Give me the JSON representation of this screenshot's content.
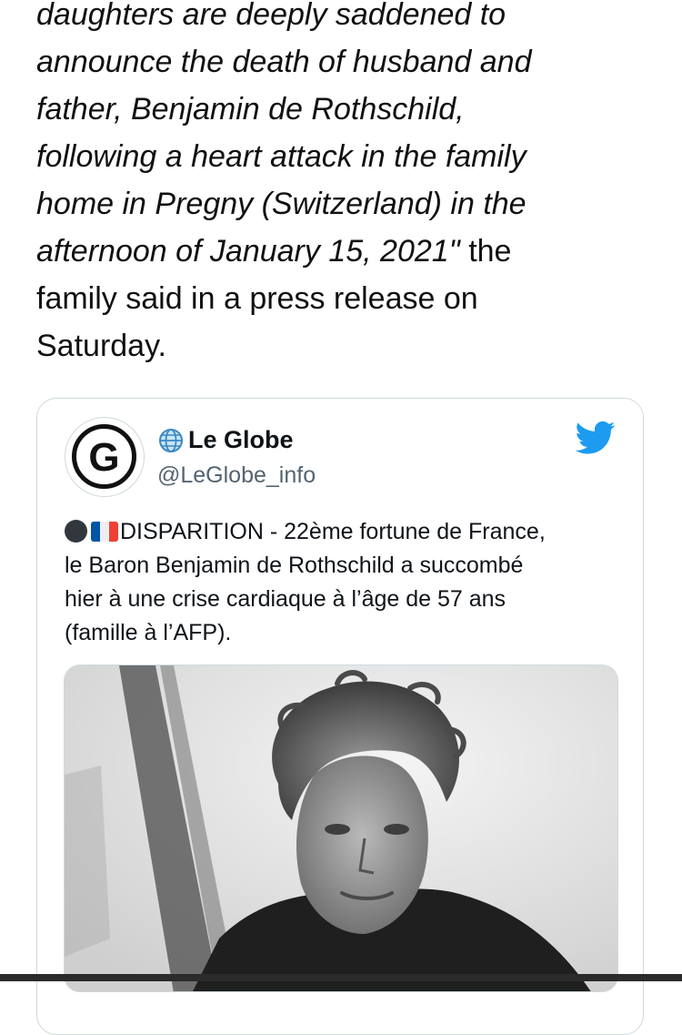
{
  "article": {
    "lines_italic": [
      "daughters are deeply saddened to",
      "announce the death of husband and",
      "father, Benjamin de Rothschild,",
      "following a heart attack in the family",
      "home in Pregny (Switzerland) in the",
      "afternoon of January 15, 2021\""
    ],
    "line6_tail": " the",
    "lines_regular": [
      "family said in a press release on",
      "Saturday."
    ]
  },
  "tweet": {
    "display_name": "Le Globe",
    "handle": "@LeGlobe_info",
    "avatar_letter": "G",
    "text_lines": [
      "DISPARITION - 22ème fortune de France,",
      "le Baron Benjamin de Rothschild a succombé",
      "hier à une crise cardiaque à l’âge de 57 ans",
      "(famille à l’AFP)."
    ],
    "icons": {
      "globe": "globe-icon",
      "bird": "twitter-bird-icon",
      "circle": "black-circle-emoji",
      "flag": "france-flag-emoji"
    },
    "colors": {
      "twitter_blue": "#1d9bf0",
      "border": "#cfd9de",
      "handle_gray": "#536471"
    }
  }
}
